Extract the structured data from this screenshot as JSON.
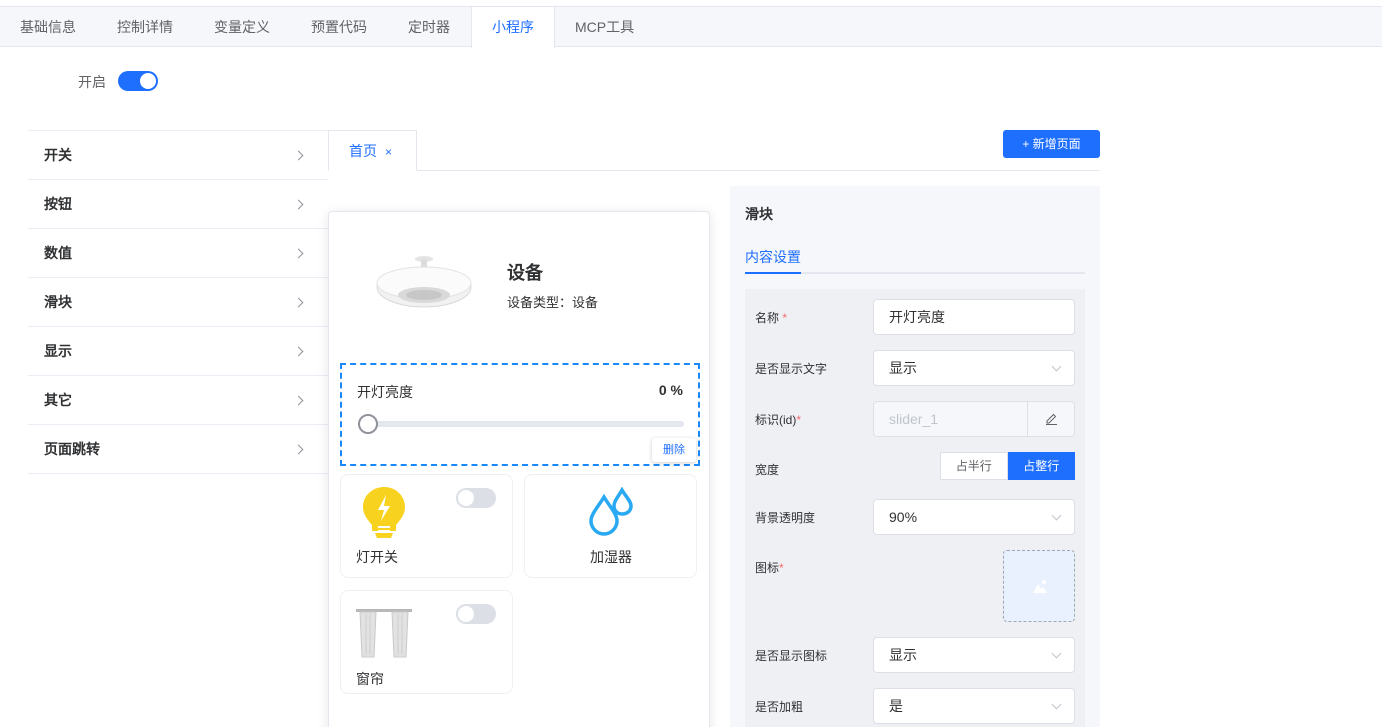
{
  "top_tabs": [
    "基础信息",
    "控制详情",
    "变量定义",
    "预置代码",
    "定时器",
    "小程序",
    "MCP工具"
  ],
  "active_top_tab": "小程序",
  "enable": {
    "label": "开启",
    "on": true
  },
  "categories": [
    "开关",
    "按钮",
    "数值",
    "滑块",
    "显示",
    "其它",
    "页面跳转"
  ],
  "page_tabs": {
    "home": "首页",
    "close": "×"
  },
  "add_page_button": "+ 新增页面",
  "device": {
    "title": "设备",
    "type_label": "设备类型：设备"
  },
  "slider_widget": {
    "name": "开灯亮度",
    "value": "0 %",
    "delete_label": "删除"
  },
  "cards": [
    {
      "label": "灯开关",
      "icon": "bulb-icon"
    },
    {
      "label": "加湿器",
      "icon": "water-drops-icon"
    },
    {
      "label": "窗帘",
      "icon": "curtain-icon"
    }
  ],
  "props": {
    "title": "滑块",
    "tab": "内容设置",
    "name_label": "名称",
    "name_value": "开灯亮度",
    "show_text_label": "是否显示文字",
    "show_text_value": "显示",
    "id_label": "标识(id)",
    "id_value": "slider_1",
    "width_label": "宽度",
    "width_half": "占半行",
    "width_full": "占整行",
    "opacity_label": "背景透明度",
    "opacity_value": "90%",
    "icon_label": "图标",
    "show_icon_label": "是否显示图标",
    "show_icon_value": "显示",
    "bold_label": "是否加粗",
    "bold_value": "是",
    "required_mark": "*"
  },
  "colors": {
    "primary": "#1f6fff",
    "required": "#f56c6c",
    "bulb": "#f7d21e",
    "drop": "#29a9f2"
  }
}
